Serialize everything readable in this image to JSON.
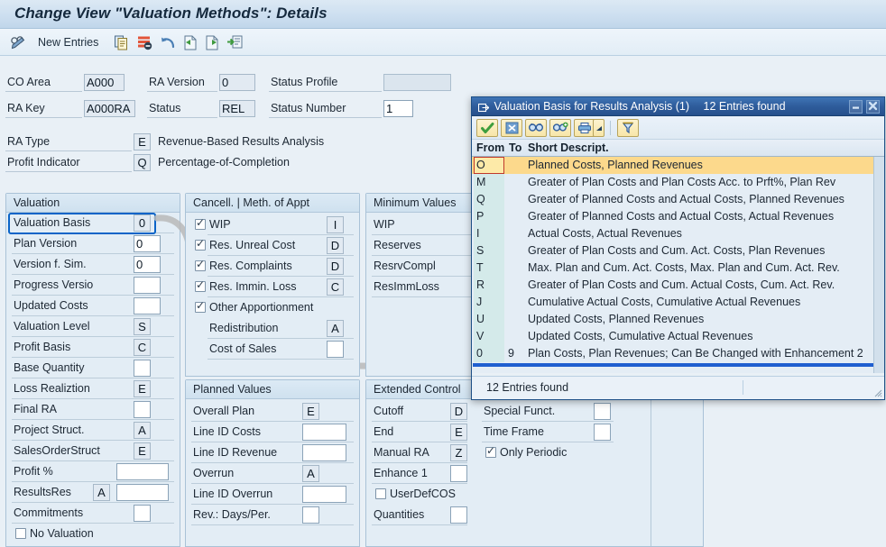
{
  "window": {
    "title": "Change View \"Valuation Methods\": Details"
  },
  "toolbar": {
    "pencil_icon": "glasses-pencil-icon",
    "new_entries_label": "New Entries",
    "icons": [
      {
        "name": "copy-icon"
      },
      {
        "name": "delete-row-icon"
      },
      {
        "name": "undo-icon"
      },
      {
        "name": "previous-entry-icon"
      },
      {
        "name": "next-entry-icon"
      },
      {
        "name": "select-layout-icon"
      }
    ]
  },
  "header": {
    "fields": [
      {
        "label": "CO Area",
        "value": "A000",
        "readonly": true
      },
      {
        "label": "RA Version",
        "value": "0",
        "readonly": true
      },
      {
        "label": "Status Profile",
        "value": "",
        "readonly": true
      },
      {
        "label": "RA Key",
        "value": "A000RA",
        "readonly": true
      },
      {
        "label": "Status",
        "value": "REL",
        "readonly": true
      },
      {
        "label": "Status Number",
        "value": "1",
        "readonly": false
      }
    ],
    "type_fields": [
      {
        "label": "RA Type",
        "value": "E",
        "desc": "Revenue-Based Results Analysis"
      },
      {
        "label": "Profit Indicator",
        "value": "Q",
        "desc": "Percentage-of-Completion"
      }
    ]
  },
  "valuation_group": {
    "title": "Valuation",
    "rows": [
      {
        "label": "Valuation Basis",
        "value": "0",
        "focused": true
      },
      {
        "label": "Plan Version",
        "value": "0"
      },
      {
        "label": "Version f. Sim.",
        "value": "0"
      },
      {
        "label": "Progress Versio",
        "value": ""
      },
      {
        "label": "Updated Costs",
        "value": ""
      },
      {
        "label": "Valuation Level",
        "value": "S"
      },
      {
        "label": "Profit Basis",
        "value": "C"
      },
      {
        "label": "Base Quantity",
        "value": ""
      },
      {
        "label": "Loss Realiztion",
        "value": "E"
      },
      {
        "label": "Final RA",
        "value": ""
      },
      {
        "label": "Project Struct.",
        "value": "A"
      },
      {
        "label": "SalesOrderStruct",
        "value": "E"
      }
    ],
    "profit_pct": {
      "label": "Profit %",
      "value": ""
    },
    "results_res": {
      "label": "ResultsRes",
      "value1": "A",
      "value2": ""
    },
    "commitments": {
      "label": "Commitments",
      "value": ""
    },
    "no_valuation": {
      "label": "No Valuation",
      "checked": false
    }
  },
  "cancell_group": {
    "title": "Cancell. | Meth. of Appt",
    "checkrows": [
      {
        "label": "WIP",
        "checked": true,
        "value": "I"
      },
      {
        "label": "Res. Unreal Cost",
        "checked": true,
        "value": "D"
      },
      {
        "label": "Res. Complaints",
        "checked": true,
        "value": "D"
      },
      {
        "label": "Res. Immin. Loss",
        "checked": true,
        "value": "C"
      },
      {
        "label": "Other Apportionment",
        "checked": true,
        "value": null
      }
    ],
    "subrows": [
      {
        "label": "Redistribution",
        "value": "A"
      },
      {
        "label": "Cost of Sales",
        "value": ""
      }
    ]
  },
  "minimum_group": {
    "title": "Minimum Values",
    "rows": [
      {
        "label": "WIP",
        "value": ""
      },
      {
        "label": "Reserves",
        "value": ""
      },
      {
        "label": "ResrvCompl",
        "value": ""
      },
      {
        "label": "ResImmLoss",
        "value": ""
      }
    ]
  },
  "planned_group": {
    "title": "Planned Values",
    "rows": [
      {
        "label": "Overall Plan",
        "value": "E",
        "narrow": true
      },
      {
        "label": "Line ID Costs",
        "value": ""
      },
      {
        "label": "Line ID Revenue",
        "value": ""
      },
      {
        "label": "Overrun",
        "value": "A",
        "narrow": true
      },
      {
        "label": "Line ID Overrun",
        "value": ""
      },
      {
        "label": "Rev.: Days/Per.",
        "value": "",
        "narrow": true
      }
    ]
  },
  "extended_group": {
    "title": "Extended Control",
    "left_rows": [
      {
        "label": "Cutoff",
        "value": "D"
      },
      {
        "label": "End",
        "value": "E"
      },
      {
        "label": "Manual RA",
        "value": "Z"
      },
      {
        "label": "Enhance 1",
        "value": ""
      }
    ],
    "left_check": {
      "label": "UserDefCOS",
      "checked": false
    },
    "left_last": {
      "label": "Quantities",
      "value": ""
    },
    "right_rows": [
      {
        "label": "Special Funct.",
        "value": ""
      },
      {
        "label": "Time Frame",
        "value": ""
      }
    ],
    "right_check": {
      "label": "Only Periodic",
      "checked": true
    }
  },
  "dialog": {
    "title": "Valuation Basis for Results Analysis (1)",
    "title_icon": "f4-help-icon",
    "subtitle": "12 Entries found",
    "minimize_label": "—",
    "close_label": "✖",
    "toolbar_buttons": [
      {
        "name": "copy-selection-button",
        "glyph": "✔"
      },
      {
        "name": "cancel-button",
        "glyph": "☒"
      },
      {
        "name": "find-button",
        "glyph": "🔭"
      },
      {
        "name": "find-next-button",
        "glyph": "🔭"
      },
      {
        "name": "print-button",
        "glyph": "⎙"
      },
      {
        "name": "print-menu-button",
        "glyph": "◢"
      },
      {
        "name": "filter-button",
        "glyph": "∇"
      }
    ],
    "columns": [
      "From",
      "To",
      "Short Descript."
    ],
    "rows": [
      {
        "from": "O",
        "to": "",
        "desc": "Planned Costs, Planned Revenues",
        "selected": true
      },
      {
        "from": "M",
        "to": "",
        "desc": "Greater of Plan Costs and Plan Costs Acc. to Prft%, Plan Rev"
      },
      {
        "from": "Q",
        "to": "",
        "desc": "Greater of Planned Costs and Actual Costs, Planned Revenues"
      },
      {
        "from": "P",
        "to": "",
        "desc": "Greater of Planned Costs and Actual Costs, Actual Revenues"
      },
      {
        "from": "I",
        "to": "",
        "desc": "Actual Costs, Actual Revenues"
      },
      {
        "from": "S",
        "to": "",
        "desc": "Greater of Plan Costs and Cum. Act. Costs, Plan Revenues"
      },
      {
        "from": "T",
        "to": "",
        "desc": "Max. Plan and Cum. Act. Costs, Max. Plan and Cum. Act. Rev."
      },
      {
        "from": "R",
        "to": "",
        "desc": "Greater of Plan Costs and Cum. Actual Costs, Cum. Act. Rev."
      },
      {
        "from": "J",
        "to": "",
        "desc": "Cumulative Actual Costs, Cumulative Actual Revenues"
      },
      {
        "from": "U",
        "to": "",
        "desc": "Updated Costs, Planned Revenues"
      },
      {
        "from": "V",
        "to": "",
        "desc": "Updated Costs, Cumulative Actual Revenues"
      },
      {
        "from": "0",
        "to": "9",
        "desc": "Plan Costs, Plan Revenues; Can Be Changed with Enhancement 2"
      }
    ],
    "footer_text": "12 Entries found"
  },
  "colors": {
    "accent_blue": "#1f5fd0",
    "focus_border": "#0a64c8",
    "dialog_title": "#2f5d9c",
    "selection_row": "#fcd98c",
    "from_col": "#d4eaea",
    "panel_bg": "#e3edf5"
  }
}
